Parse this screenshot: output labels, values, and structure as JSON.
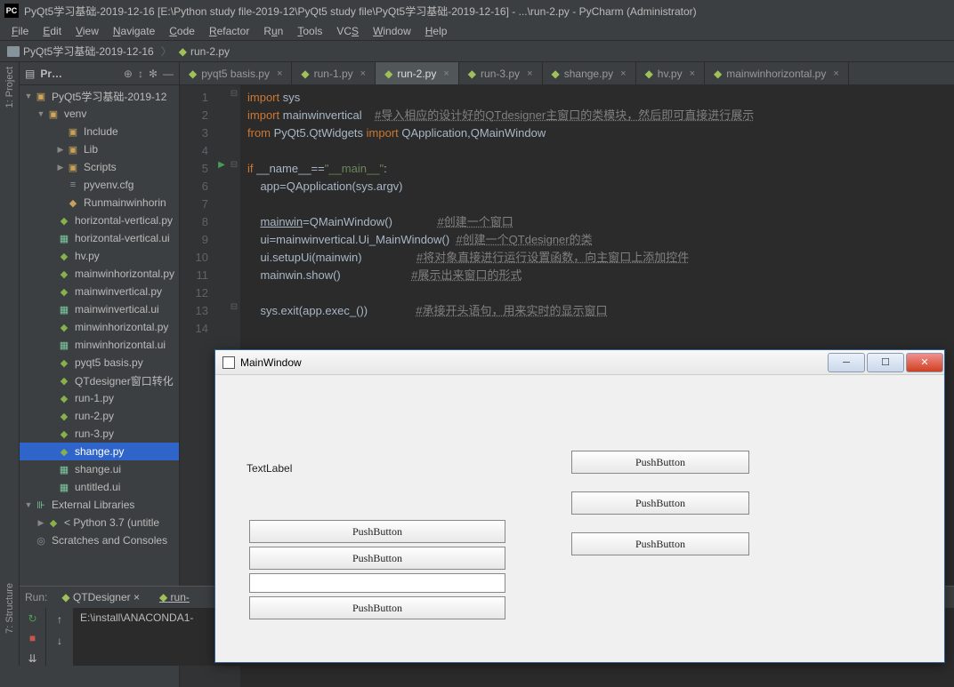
{
  "titlebar": "PyQt5学习基础-2019-12-16 [E:\\Python study file-2019-12\\PyQt5 study file\\PyQt5学习基础-2019-12-16] - ...\\run-2.py - PyCharm (Administrator)",
  "menu": [
    "File",
    "Edit",
    "View",
    "Navigate",
    "Code",
    "Refactor",
    "Run",
    "Tools",
    "VCS",
    "Window",
    "Help"
  ],
  "breadcrumb": {
    "root": "PyQt5学习基础-2019-12-16",
    "file": "run-2.py"
  },
  "project_panel": {
    "header": "Pr…"
  },
  "tree": {
    "root": "PyQt5学习基础-2019-12",
    "venv": "venv",
    "include": "Include",
    "lib": "Lib",
    "scripts": "Scripts",
    "pyvenv": "pyvenv.cfg",
    "runmain": "Runmainwinhorin",
    "files": [
      {
        "name": "horizontal-vertical.py",
        "type": "py"
      },
      {
        "name": "horizontal-vertical.ui",
        "type": "ui"
      },
      {
        "name": "hv.py",
        "type": "py"
      },
      {
        "name": "mainwinhorizontal.py",
        "type": "py"
      },
      {
        "name": "mainwinvertical.py",
        "type": "py"
      },
      {
        "name": "mainwinvertical.ui",
        "type": "ui"
      },
      {
        "name": "minwinhorizontal.py",
        "type": "py"
      },
      {
        "name": "minwinhorizontal.ui",
        "type": "ui"
      },
      {
        "name": "pyqt5 basis.py",
        "type": "py"
      },
      {
        "name": "QTdesigner窗口转化",
        "type": "py"
      },
      {
        "name": "run-1.py",
        "type": "py"
      },
      {
        "name": "run-2.py",
        "type": "py"
      },
      {
        "name": "run-3.py",
        "type": "py"
      },
      {
        "name": "shange.py",
        "type": "py",
        "selected": true
      },
      {
        "name": "shange.ui",
        "type": "ui"
      },
      {
        "name": "untitled.ui",
        "type": "ui"
      }
    ],
    "extlib": "External Libraries",
    "python": "< Python 3.7 (untitle",
    "scratch": "Scratches and Consoles"
  },
  "tabs": [
    {
      "label": "pyqt5 basis.py"
    },
    {
      "label": "run-1.py"
    },
    {
      "label": "run-2.py",
      "active": true
    },
    {
      "label": "run-3.py"
    },
    {
      "label": "shange.py"
    },
    {
      "label": "hv.py"
    },
    {
      "label": "mainwinhorizontal.py"
    }
  ],
  "code": {
    "lines": [
      {
        "n": 1,
        "html": "<span class='kw'>import</span> sys"
      },
      {
        "n": 2,
        "html": "<span class='kw'>import</span> mainwinvertical    <span class='com'>#导入相应的设计好的QTdesigner主窗口的类模块，然后即可直接进行展示</span>"
      },
      {
        "n": 3,
        "html": "<span class='kw'>from</span> PyQt5.QtWidgets <span class='kw'>import</span> QApplication,QMainWindow"
      },
      {
        "n": 4,
        "html": ""
      },
      {
        "n": 5,
        "html": "<span class='kw'>if</span> __name__==<span class='str'>\"__main__\"</span>:"
      },
      {
        "n": 6,
        "html": "    app=QApplication(sys.argv)"
      },
      {
        "n": 7,
        "html": ""
      },
      {
        "n": 8,
        "html": "    <span class='u'>mainwin</span>=QMainWindow()              <span class='com'>#创建一个窗口</span>"
      },
      {
        "n": 9,
        "html": "    ui=mainwinvertical.Ui_MainWindow()  <span class='com'>#创建一个QTdesigner的类</span>"
      },
      {
        "n": 10,
        "html": "    ui.setupUi(mainwin)                 <span class='com'>#将对象直接进行运行设置函数，向主窗口上添加控件</span>"
      },
      {
        "n": 11,
        "html": "    mainwin.show()                      <span class='com'>#展示出来窗口的形式</span>"
      },
      {
        "n": 12,
        "html": ""
      },
      {
        "n": 13,
        "html": "    sys.exit(app.exec_())               <span class='com'>#承接开头语句，用来实时的显示窗口</span>"
      },
      {
        "n": 14,
        "html": ""
      }
    ]
  },
  "run_panel": {
    "label": "Run:",
    "tab1": "QTDesigner",
    "tab2": "run-",
    "output": "E:\\install\\ANACONDA1-"
  },
  "left_labels": {
    "project": "1: Project",
    "structure": "7: Structure"
  },
  "qt": {
    "title": "MainWindow",
    "label": "TextLabel",
    "btn": "PushButton"
  }
}
